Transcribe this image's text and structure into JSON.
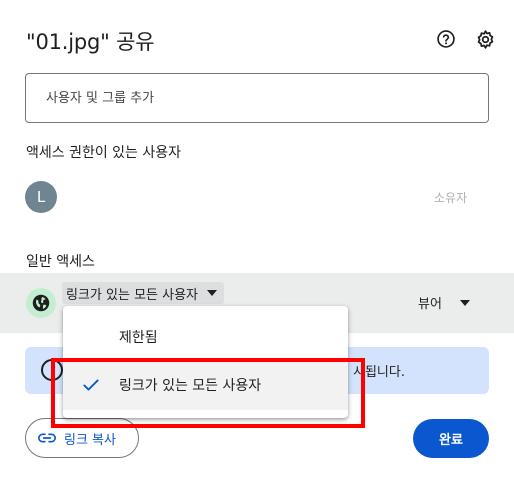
{
  "dialog": {
    "title": "\"01.jpg\" 공유",
    "help_icon": "help-circle-icon",
    "settings_icon": "gear-icon"
  },
  "add_people": {
    "placeholder": "사용자 및 그룹 추가"
  },
  "people_with_access": {
    "heading": "액세스 권한이 있는 사용자",
    "people": [
      {
        "avatar_letter": "L",
        "avatar_color": "#6f8592",
        "role": "소유자"
      }
    ]
  },
  "general_access": {
    "heading": "일반 액세스",
    "icon": "globe-icon",
    "link_setting": "링크가 있는 모든 사용자",
    "role": "뷰어",
    "banner_icon": "info-icon",
    "banner_text": "시됩니다."
  },
  "dropdown": {
    "items": [
      {
        "label": "제한됨",
        "selected": false
      },
      {
        "label": "링크가 있는 모든 사용자",
        "selected": true
      }
    ]
  },
  "footer": {
    "copy_link_label": "링크 복사",
    "done_label": "완료"
  },
  "colors": {
    "accent": "#0b57d0",
    "banner_bg": "#d3e3fd",
    "globe_bg": "#c4eed0",
    "highlight": "#ff0000"
  }
}
